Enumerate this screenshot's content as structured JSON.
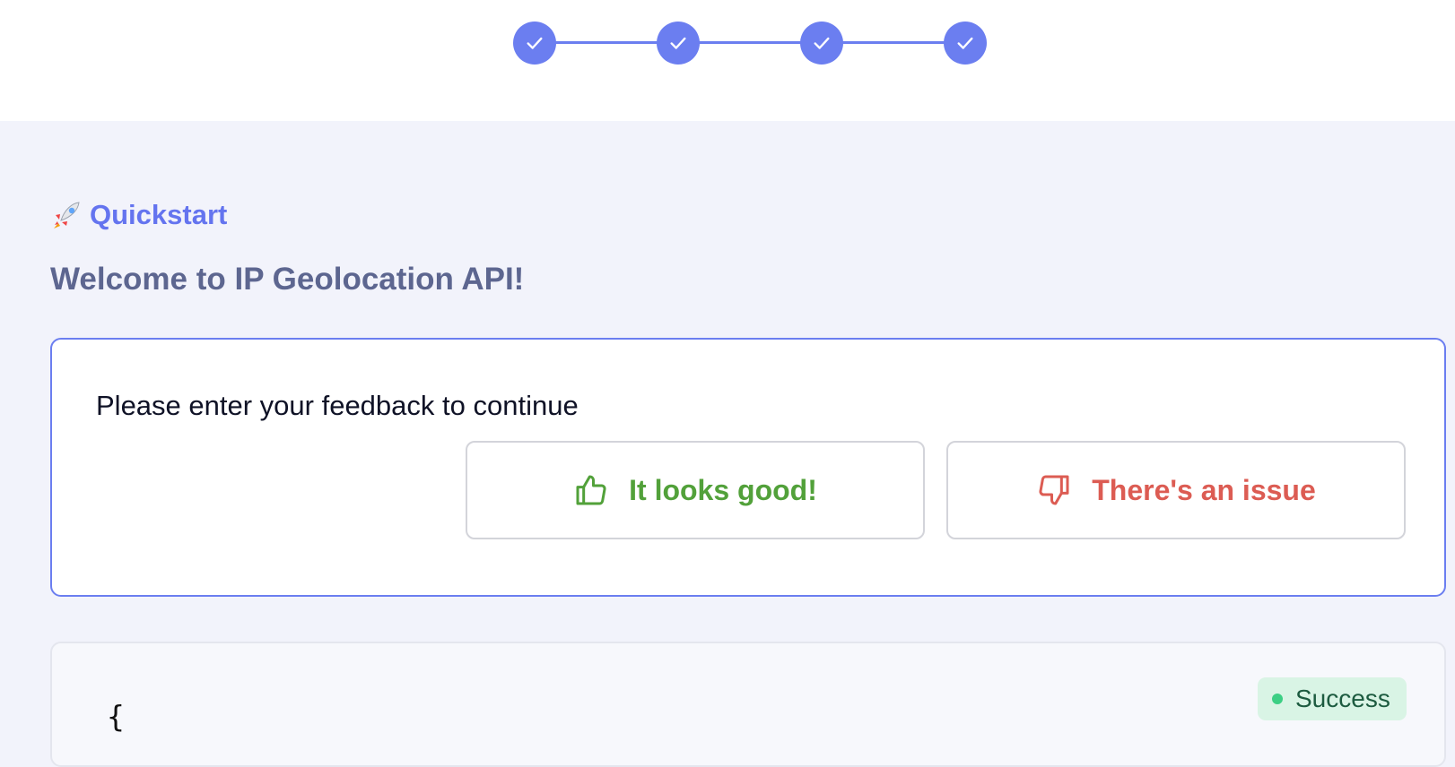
{
  "stepper": {
    "steps": [
      {
        "state": "completed",
        "icon": "check-icon"
      },
      {
        "state": "completed",
        "icon": "check-icon"
      },
      {
        "state": "completed",
        "icon": "check-icon"
      },
      {
        "state": "completed",
        "icon": "check-icon"
      }
    ],
    "accent_color": "#6b7ef0"
  },
  "header": {
    "section_icon": "rocket-icon",
    "section_label": "Quickstart",
    "title": "Welcome to IP Geolocation API!"
  },
  "feedback": {
    "prompt": "Please enter your feedback to continue",
    "good": {
      "icon": "thumbs-up-icon",
      "label": "It looks good!",
      "color": "#52a13a"
    },
    "issue": {
      "icon": "thumbs-down-icon",
      "label": "There's an issue",
      "color": "#dc5c53"
    }
  },
  "response": {
    "code_start": "{",
    "status": {
      "label": "Success",
      "color": "#3ccf84"
    }
  }
}
